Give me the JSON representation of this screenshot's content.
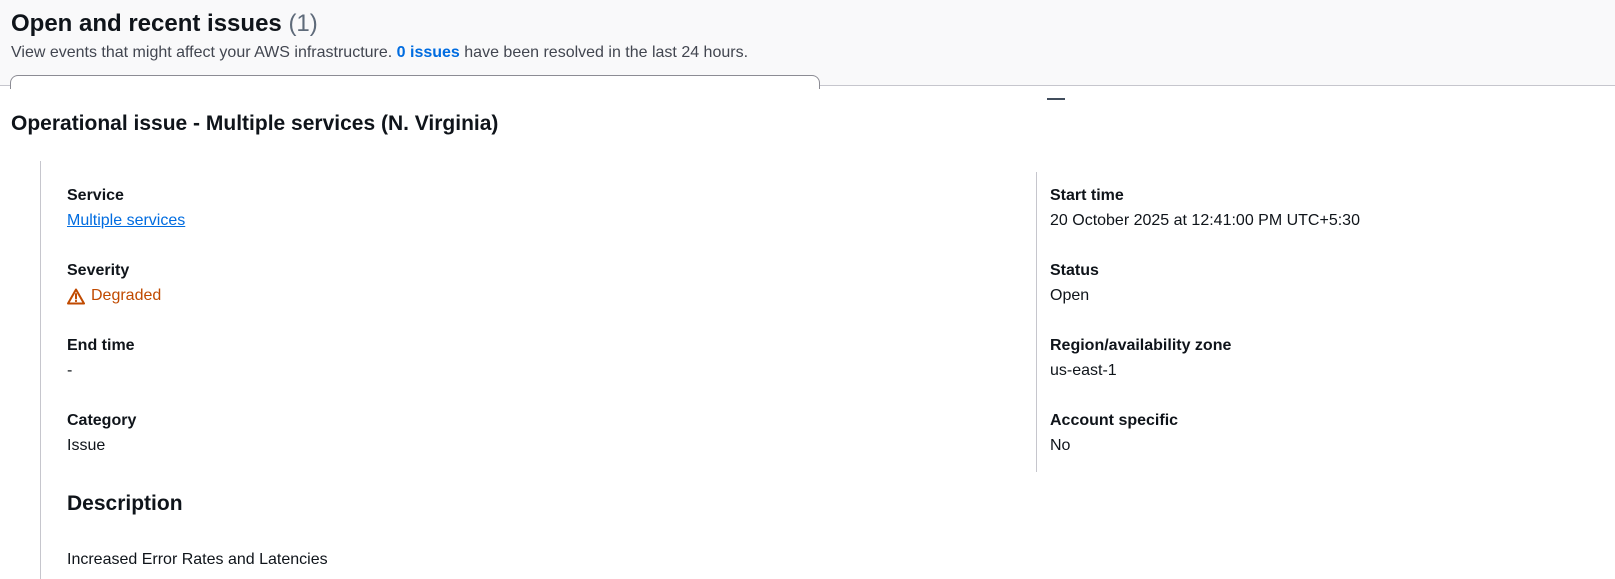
{
  "header": {
    "title": "Open and recent issues",
    "count": "(1)",
    "subtitle_before": "View events that might affect your AWS infrastructure.",
    "issues_link": "0 issues",
    "subtitle_after": "have been resolved in the last 24 hours."
  },
  "panel": {
    "title": "Operational issue - Multiple services (N. Virginia)"
  },
  "details": {
    "service": {
      "label": "Service",
      "value": "Multiple services"
    },
    "severity": {
      "label": "Severity",
      "value": "Degraded",
      "icon": "warning-icon",
      "color": "#c04a00"
    },
    "end_time": {
      "label": "End time",
      "value": "-"
    },
    "category": {
      "label": "Category",
      "value": "Issue"
    },
    "start_time": {
      "label": "Start time",
      "value": "20 October 2025 at 12:41:00 PM UTC+5:30"
    },
    "status": {
      "label": "Status",
      "value": "Open"
    },
    "region": {
      "label": "Region/availability zone",
      "value": "us-east-1"
    },
    "account_specific": {
      "label": "Account specific",
      "value": "No"
    }
  },
  "description": {
    "heading": "Description",
    "text": "Increased Error Rates and Latencies"
  },
  "colors": {
    "link": "#006ce0",
    "warning": "#c04a00",
    "text": "#0f141a",
    "muted": "#424650"
  }
}
